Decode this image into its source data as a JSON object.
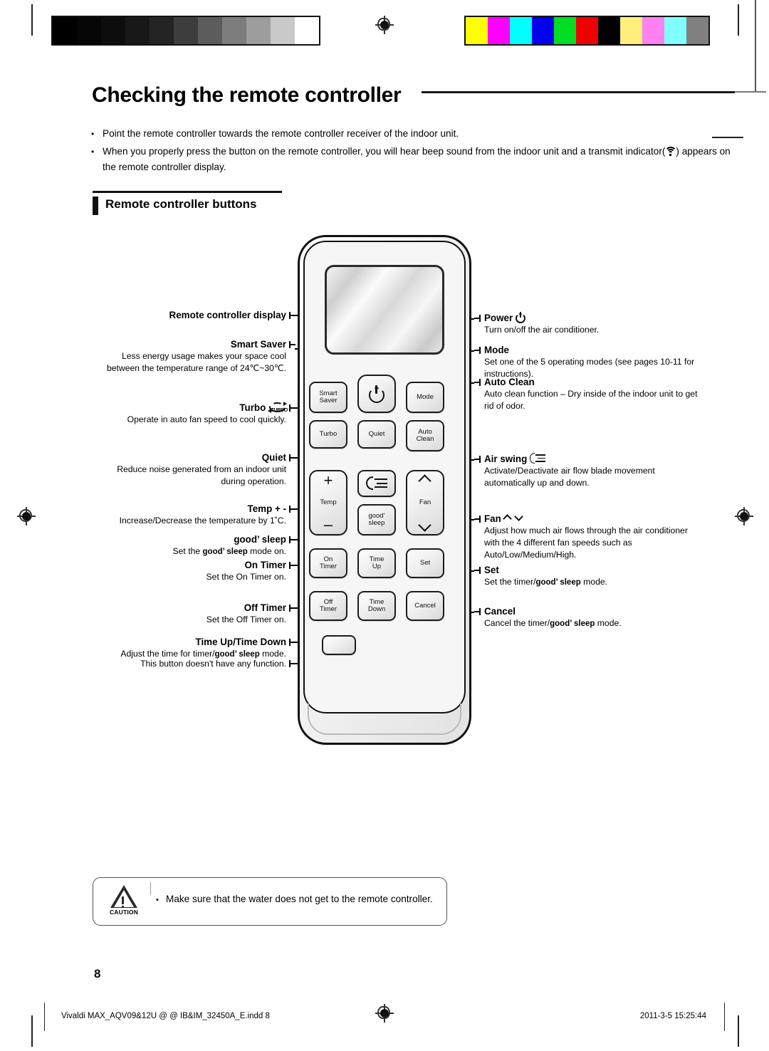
{
  "document": {
    "title": "Checking the remote controller",
    "page_number": "8",
    "footer_file": "Vivaldi MAX_AQV09&12U @ @ IB&IM_32450A_E.indd   8",
    "footer_date": "2011-3-5   15:25:44"
  },
  "intro": {
    "bullets": [
      "Point the remote controller towards the remote controller receiver of the indoor unit.",
      "When you properly press the button on the remote controller, you will hear beep sound from the indoor unit and a transmit indicator(",
      ") appears on the remote controller display."
    ]
  },
  "section": {
    "heading": "Remote controller buttons"
  },
  "remote": {
    "buttons": {
      "power": "",
      "smart_saver": "Smart\nSaver",
      "smart_saver_l1": "Smart",
      "smart_saver_l2": "Saver",
      "mode": "Mode",
      "turbo": "Turbo",
      "quiet": "Quiet",
      "auto_clean_l1": "Auto",
      "auto_clean_l2": "Clean",
      "temp": "Temp",
      "temp_plus": "+",
      "temp_minus": "–",
      "fan": "Fan",
      "good_sleep_l1": "good’",
      "good_sleep_l2": "sleep",
      "on_timer_l1": "On",
      "on_timer_l2": "Timer",
      "time_up_l1": "Time",
      "time_up_l2": "Up",
      "set": "Set",
      "off_timer_l1": "Off",
      "off_timer_l2": "Timer",
      "time_down_l1": "Time",
      "time_down_l2": "Down",
      "cancel": "Cancel",
      "blank": ""
    }
  },
  "callouts_left": [
    {
      "title": "Remote controller display",
      "body": ""
    },
    {
      "title": "Smart Saver",
      "body": "Less energy usage makes your space cool between the temperature range of 24℃~30℃."
    },
    {
      "title": "Turbo",
      "icon": "turbo-icon",
      "body": "Operate in auto fan speed to cool quickly."
    },
    {
      "title": "Quiet",
      "body": "Reduce noise generated from an indoor unit during operation."
    },
    {
      "title": "Temp + -",
      "body": "Increase/Decrease the temperature by 1˚C."
    },
    {
      "title": "good’ sleep",
      "body_pre": "Set the ",
      "body_bold": "good’ sleep",
      "body_post": " mode on."
    },
    {
      "title": "On Timer",
      "body": "Set the On Timer on."
    },
    {
      "title": "Off Timer",
      "body": "Set the Off Timer on."
    },
    {
      "title": "Time Up/Time Down",
      "body_pre": "Adjust the time for timer/",
      "body_bold": "good’ sleep",
      "body_post": " mode."
    },
    {
      "title": "",
      "body": "This button doesn't have any function."
    }
  ],
  "callouts_right": [
    {
      "title": "Power",
      "icon": "power-icon",
      "body": "Turn on/off the air conditioner."
    },
    {
      "title": "Mode",
      "body": "Set one of the 5 operating modes (see pages 10-11 for instructions)."
    },
    {
      "title": "Auto Clean",
      "body": "Auto clean function – Dry inside of the indoor unit to get rid of odor."
    },
    {
      "title": "Air swing",
      "icon": "air-swing-icon",
      "body": "Activate/Deactivate air flow blade movement automatically up and down."
    },
    {
      "title": "Fan",
      "icon": "fan-updown-icon",
      "body": "Adjust how much air flows through the air conditioner with the 4 different fan speeds such as Auto/Low/Medium/High."
    },
    {
      "title": "Set",
      "body_pre": "Set the timer/",
      "body_bold": "good’ sleep",
      "body_post": " mode."
    },
    {
      "title": "Cancel",
      "body_pre": "Cancel the timer/",
      "body_bold": "good’ sleep",
      "body_post": " mode."
    }
  ],
  "caution": {
    "label": "CAUTION",
    "bullet": "•",
    "text": "Make sure that the water does not get to the remote controller."
  },
  "print_bars": {
    "grayscale": [
      "#000000",
      "#050505",
      "#0d0d0d",
      "#181818",
      "#242424",
      "#3d3d3d",
      "#5c5c5c",
      "#7d7d7d",
      "#9d9d9d",
      "#c9c9c9",
      "#ffffff"
    ],
    "color": [
      "#ffff00",
      "#ff00ff",
      "#00ffff",
      "#0000ee",
      "#00dd22",
      "#ee0000",
      "#000000",
      "#ffef7d",
      "#ff80f0",
      "#80ffff",
      "#808080"
    ]
  }
}
